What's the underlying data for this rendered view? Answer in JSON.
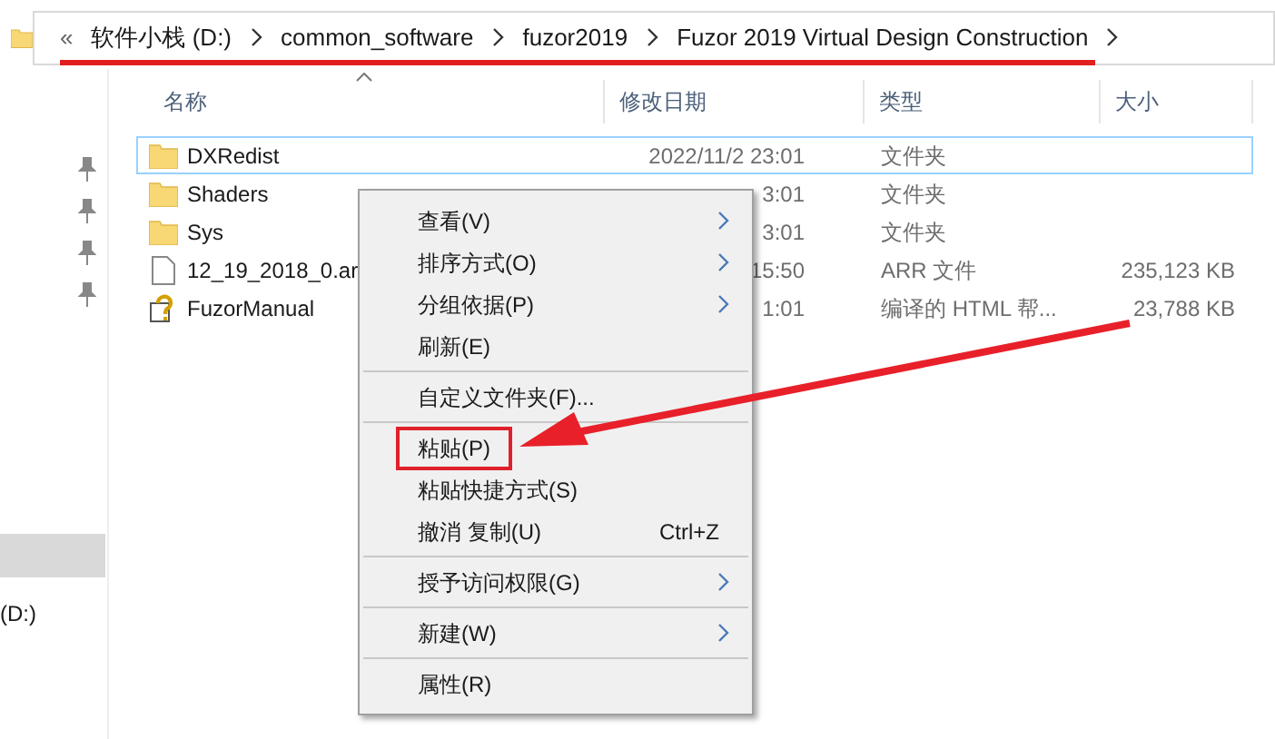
{
  "address_bar": {
    "overflow": "«",
    "crumbs": [
      "软件小栈 (D:)",
      "common_software",
      "fuzor2019",
      "Fuzor 2019 Virtual Design Construction"
    ]
  },
  "sidebar": {
    "items": [
      {
        "selected": true
      },
      {
        "label": "(D:)",
        "selected": false
      }
    ]
  },
  "table": {
    "columns": [
      {
        "label": "名称",
        "sorted": true
      },
      {
        "label": "修改日期",
        "sorted": false
      },
      {
        "label": "类型",
        "sorted": false
      },
      {
        "label": "大小",
        "sorted": false
      }
    ],
    "rows": [
      {
        "kind": "folder",
        "name": "DXRedist",
        "modified": "2022/11/2 23:01",
        "type": "文件夹",
        "selected": true
      },
      {
        "kind": "folder",
        "name": "Shaders",
        "modified": "3:01",
        "type": "文件夹",
        "selected": false
      },
      {
        "kind": "folder",
        "name": "Sys",
        "modified": "3:01",
        "type": "文件夹",
        "selected": false
      },
      {
        "kind": "file",
        "name": "12_19_2018_0.ar",
        "modified": "15:50",
        "type": "ARR 文件",
        "size": "235,123 KB",
        "selected": false
      },
      {
        "kind": "help",
        "name": "FuzorManual",
        "modified": "1:01",
        "type": "编译的 HTML 帮...",
        "size": "23,788 KB",
        "selected": false
      }
    ]
  },
  "context_menu": {
    "groups": [
      [
        {
          "label": "查看(V)",
          "submenu": true,
          "highlighted": false
        },
        {
          "label": "排序方式(O)",
          "submenu": true,
          "highlighted": false
        },
        {
          "label": "分组依据(P)",
          "submenu": true,
          "highlighted": false
        },
        {
          "label": "刷新(E)",
          "submenu": false,
          "highlighted": false
        }
      ],
      [
        {
          "label": "自定义文件夹(F)...",
          "submenu": false,
          "highlighted": false
        }
      ],
      [
        {
          "label": "粘贴(P)",
          "submenu": false,
          "highlighted": true
        },
        {
          "label": "粘贴快捷方式(S)",
          "submenu": false,
          "highlighted": false
        },
        {
          "label": "撤消 复制(U)",
          "shortcut": "Ctrl+Z",
          "submenu": false,
          "highlighted": false
        }
      ],
      [
        {
          "label": "授予访问权限(G)",
          "submenu": true,
          "highlighted": false
        }
      ],
      [
        {
          "label": "新建(W)",
          "submenu": true,
          "highlighted": false
        }
      ],
      [
        {
          "label": "属性(R)",
          "submenu": false,
          "highlighted": false
        }
      ]
    ]
  }
}
